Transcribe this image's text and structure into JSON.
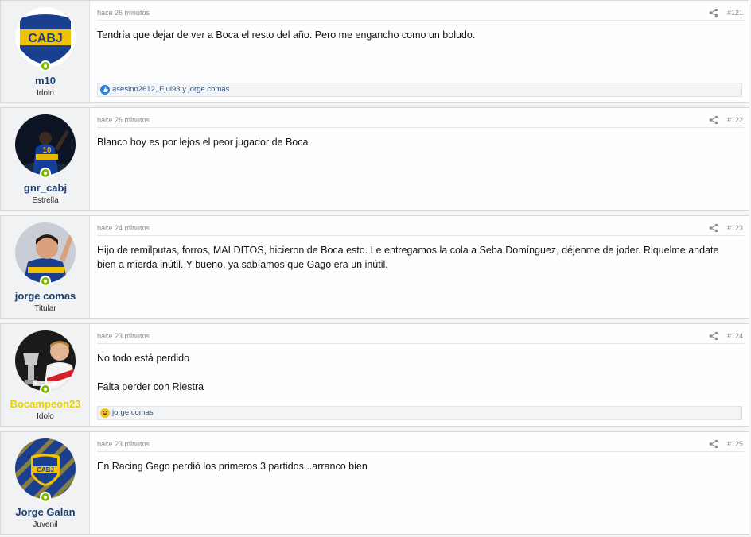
{
  "posts": [
    {
      "username": "m10",
      "user_title": "Idolo",
      "time": "hace 26 minutos",
      "number": "#121",
      "paragraphs": [
        "Tendría que dejar de ver a Boca el resto del año. Pero me engancho como un boludo."
      ],
      "reactions": "asesino2612, Ejul93 y jorge comas",
      "reaction_icon": "like-icon",
      "avatar": "cabj-shield-avatar"
    },
    {
      "username": "gnr_cabj",
      "user_title": "Estrella",
      "time": "hace 26 minutos",
      "number": "#122",
      "paragraphs": [
        "Blanco hoy es por lejos el peor jugador de Boca"
      ],
      "avatar": "player-photo-avatar"
    },
    {
      "username": "jorge comas",
      "user_title": "Titular",
      "time": "hace 24 minutos",
      "number": "#123",
      "paragraphs": [
        "Hijo de remilputas, forros, MALDITOS, hicieron de Boca esto. Le entregamos la cola a Seba Domínguez, déjenme de joder. Riquelme andate bien a mierda inútil. Y bueno, ya sabíamos que Gago era un inútil."
      ],
      "avatar": "player-photo-avatar"
    },
    {
      "username": "Bocampeon23",
      "user_title": "Idolo",
      "time": "hace 23 minutos",
      "number": "#124",
      "paragraphs": [
        "No todo está perdido",
        "Falta perder con Riestra"
      ],
      "reactions": "jorge comas",
      "reaction_icon": "haha-icon",
      "avatar": "player-with-trophy-avatar"
    },
    {
      "username": "Jorge Galan",
      "user_title": "Juvenil",
      "time": "hace 23 minutos",
      "number": "#125",
      "paragraphs": [
        "En Racing Gago perdió los primeros 3 partidos...arranco bien"
      ],
      "avatar": "cabj-badge-avatar"
    }
  ],
  "colors": {
    "username": "#1e3f6e",
    "username_gold": "#e8d000",
    "online": "#7fb900",
    "boca_blue": "#1b3f8f",
    "boca_gold": "#f2c200"
  }
}
